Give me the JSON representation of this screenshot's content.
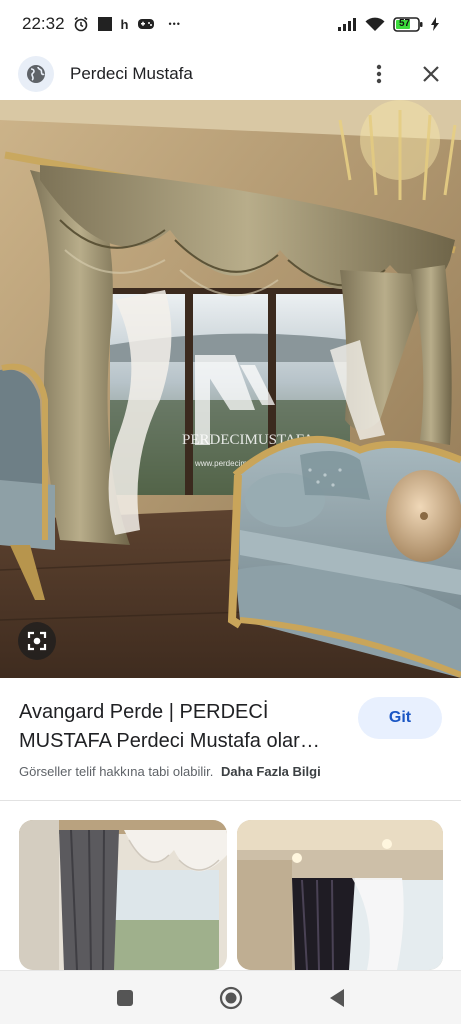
{
  "status_bar": {
    "time": "22:32",
    "carrier_letter": "h",
    "more_dots": "•••",
    "battery_level": "57",
    "icons": [
      "alarm-icon",
      "square-notification-icon",
      "gamepad-icon",
      "signal-icon",
      "wifi-icon",
      "battery-icon",
      "charging-bolt-icon"
    ]
  },
  "top_bar": {
    "title": "Perdeci Mustafa",
    "icons": [
      "globe-icon",
      "more-vert-icon",
      "close-icon"
    ]
  },
  "hero": {
    "watermark_text": "PERDECIMUSTAFA",
    "watermark_url": "www.perdecimustafa.com"
  },
  "info": {
    "title_line1": "Avangard Perde | PERDECİ",
    "title_line2": "MUSTAFA Perdeci Mustafa olar…",
    "visit_button": "Git",
    "copyright_text": "Görseller telif hakkına tabi olabilir.",
    "more_info_link": "Daha Fazla Bilgi"
  },
  "nav_bar": {
    "icons": [
      "recents-square-icon",
      "home-circle-icon",
      "back-triangle-icon"
    ]
  },
  "colors": {
    "accent": "#1a56c4",
    "accent_bg": "#e8f0fe",
    "battery_green": "#3ddc3d"
  }
}
